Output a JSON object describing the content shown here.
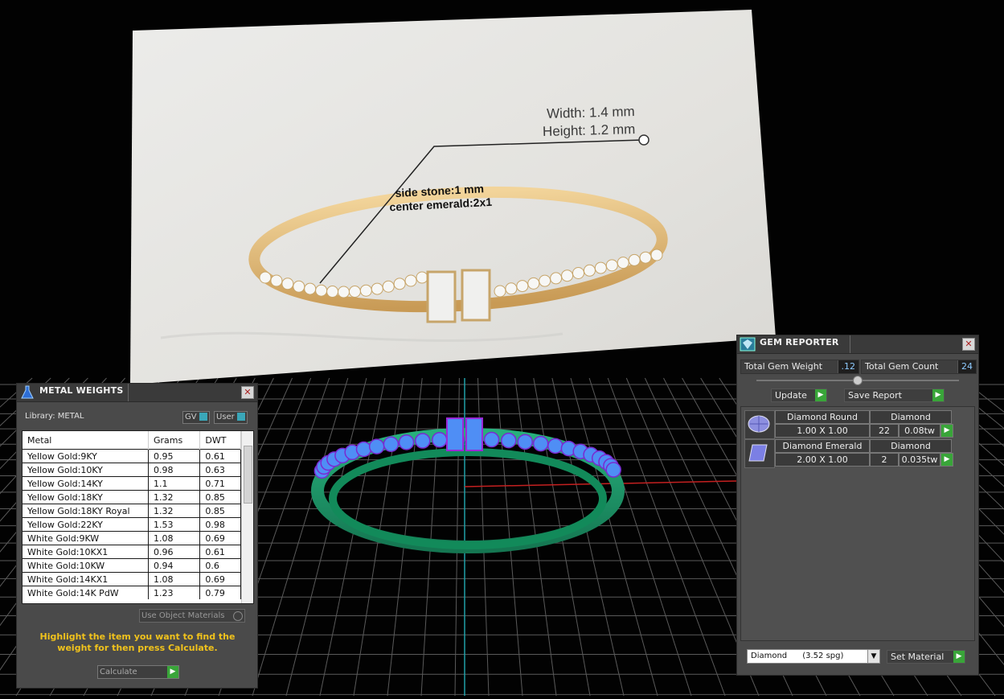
{
  "photo": {
    "width_label": "Width: 1.4 mm",
    "height_label": "Height: 1.2 mm",
    "side_stone_label": "side stone:1 mm",
    "center_label": "center emerald:2x1"
  },
  "metal_weights": {
    "title": "METAL WEIGHTS",
    "library_label": "Library: METAL",
    "gv_label": "GV",
    "user_label": "User",
    "columns": [
      "Metal",
      "Grams",
      "DWT"
    ],
    "rows": [
      [
        "Yellow Gold:9KY",
        "0.95",
        "0.61"
      ],
      [
        "Yellow Gold:10KY",
        "0.98",
        "0.63"
      ],
      [
        "Yellow Gold:14KY",
        "1.1",
        "0.71"
      ],
      [
        "Yellow Gold:18KY",
        "1.32",
        "0.85"
      ],
      [
        "Yellow Gold:18KY Royal",
        "1.32",
        "0.85"
      ],
      [
        "Yellow Gold:22KY",
        "1.53",
        "0.98"
      ],
      [
        "White Gold:9KW",
        "1.08",
        "0.69"
      ],
      [
        "White Gold:10KX1",
        "0.96",
        "0.61"
      ],
      [
        "White Gold:10KW",
        "0.94",
        "0.6"
      ],
      [
        "White Gold:14KX1",
        "1.08",
        "0.69"
      ],
      [
        "White Gold:14K PdW",
        "1.23",
        "0.79"
      ]
    ],
    "use_object_label": "Use Object Materials",
    "hint": "Highlight the item you want to find the weight for then press Calculate.",
    "calc_label": "Calculate"
  },
  "gem_reporter": {
    "title": "GEM REPORTER",
    "total_weight_label": "Total Gem Weight",
    "total_weight_value": ".12",
    "total_count_label": "Total Gem Count",
    "total_count_value": "24",
    "update_label": "Update",
    "save_label": "Save Report",
    "gems": [
      {
        "shape": "Diamond Round",
        "material": "Diamond",
        "size": "1.00 X 1.00",
        "count": "22",
        "weight": "0.08tw"
      },
      {
        "shape": "Diamond Emerald",
        "material": "Diamond",
        "size": "2.00 X 1.00",
        "count": "2",
        "weight": "0.035tw"
      }
    ],
    "material_select": "Diamond      (3.52 spg)",
    "set_material_label": "Set Material"
  },
  "colors": {
    "accent_green": "#39a539",
    "hint_yellow": "#f0c21c",
    "ring_green": "#1f9b6c",
    "gem_blue": "#4f8ef5"
  }
}
